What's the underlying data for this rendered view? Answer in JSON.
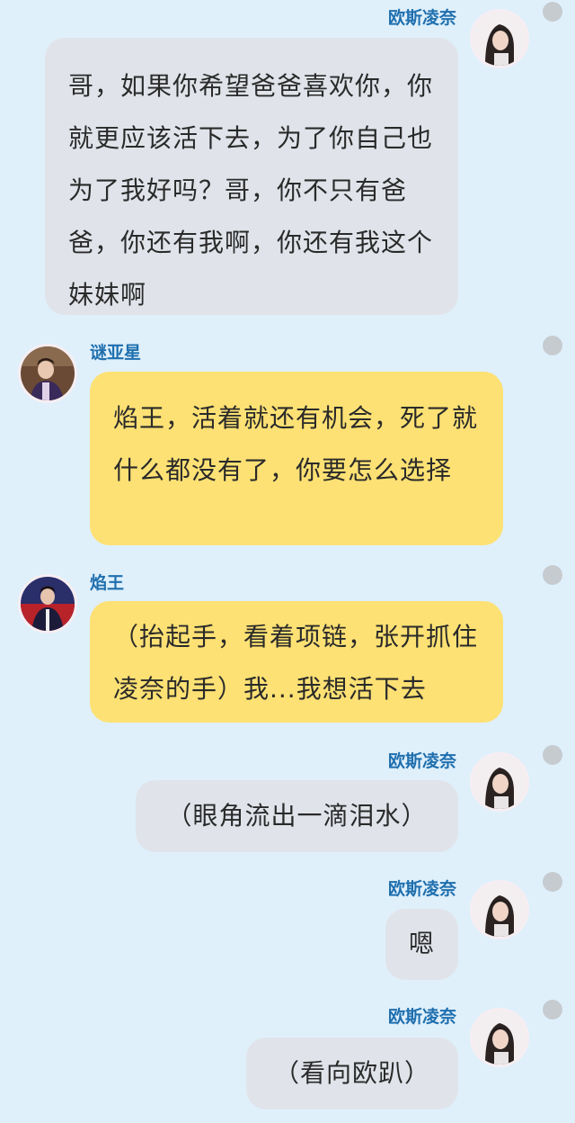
{
  "messages": [
    {
      "sender": "欧斯凌奈",
      "text": "哥，如果你希望爸爸喜欢你，你就更应该活下去，为了你自己也为了我好吗？哥，你不只有爸爸，你还有我啊，你还有我这个妹妹啊",
      "avatar": "girl-avatar-icon"
    },
    {
      "sender": "谜亚星",
      "text": "焰王，活着就还有机会，死了就什么都没有了，你要怎么选择",
      "avatar": "boy-avatar-icon"
    },
    {
      "sender": "焰王",
      "text": "（抬起手，看着项链，张开抓住凌奈的手）我...我想活下去",
      "avatar": "boy2-avatar-icon"
    },
    {
      "sender": "欧斯凌奈",
      "text": "（眼角流出一滴泪水）",
      "avatar": "girl-avatar-icon"
    },
    {
      "sender": "欧斯凌奈",
      "text": "嗯",
      "avatar": "girl-avatar-icon"
    },
    {
      "sender": "欧斯凌奈",
      "text": "（看向欧趴）",
      "avatar": "girl-avatar-icon"
    }
  ],
  "colors": {
    "background": "#dff0fb",
    "gray_bubble": "#e0e4ea",
    "yellow_bubble": "#fde174",
    "name": "#1f6fae"
  }
}
